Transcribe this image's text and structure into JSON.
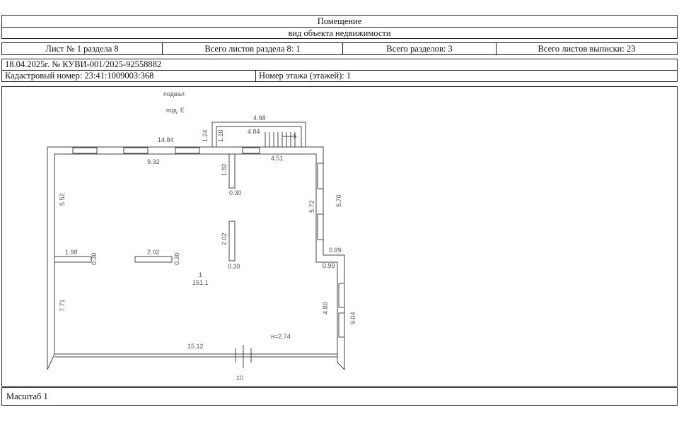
{
  "header": {
    "title": "Помещение",
    "subtitle": "вид объекта недвижимости"
  },
  "sheet_info": {
    "sheet": "Лист № 1 раздела 8",
    "total_section_sheets": "Всего листов раздела 8: 1",
    "total_sections": "Всего разделов: 3",
    "total_extract_sheets": "Всего листов выписки: 23"
  },
  "record": {
    "date_number": "18.04.2025г. № КУВИ-001/2025-92558882",
    "cadastral_number": "Кадастровый номер: 23:41:1009003:368",
    "floor_number": "Номер этажа (этажей): 1"
  },
  "plan": {
    "labels": {
      "podval": "подвал",
      "pod_e": "под. Е",
      "room_number": "1",
      "room_area": "151.1",
      "height": "н=2.74",
      "bottom_marker": "10"
    },
    "dimensions": {
      "d_4_98": "4.98",
      "d_4_84": "4.84",
      "d_1_24": "1.24",
      "d_1_10": "1.10",
      "d_14_84": "14.84",
      "d_9_32": "9.32",
      "d_4_51": "4.51",
      "d_1_82": "1.82",
      "d_0_30_a": "0.30",
      "d_5_52": "5.52",
      "d_5_72": "5.72",
      "d_5_70": "5.70",
      "d_2_02_v": "2.02",
      "d_0_30_b": "0.30",
      "d_1_98": "1.98",
      "d_0_30_c": "0.30",
      "d_2_02_h": "2.02",
      "d_0_30_d": "0.30",
      "d_0_99_a": "0.99",
      "d_0_99_b": "0.99",
      "d_7_71": "7.71",
      "d_4_80": "4.80",
      "d_9_04": "9.04",
      "d_15_12": "15.12"
    }
  },
  "footer": {
    "scale": "Масштаб 1"
  }
}
